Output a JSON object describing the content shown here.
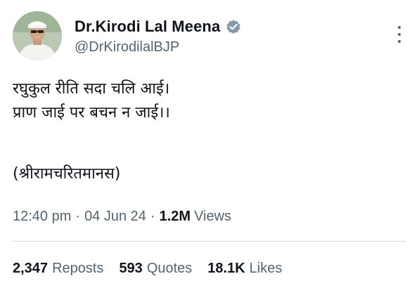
{
  "author": {
    "display_name": "Dr.Kirodi Lal Meena",
    "handle": "@DrKirodilalBJP",
    "verified": true,
    "avatar_icon": "profile-photo"
  },
  "tweet": {
    "lines": [
      "रघुकुल रीति सदा चलि आई।",
      "प्राण जाई पर बचन न जाई।।"
    ],
    "source": "(श्रीरामचरितमानस)"
  },
  "meta": {
    "time": "12:40 pm",
    "separator": "·",
    "date": "04 Jun 24",
    "views_count": "1.2M",
    "views_label": "Views"
  },
  "stats": {
    "reposts_count": "2,347",
    "reposts_label": "Reposts",
    "quotes_count": "593",
    "quotes_label": "Quotes",
    "likes_count": "18.1K",
    "likes_label": "Likes"
  },
  "colors": {
    "text_primary": "#0f1419",
    "text_secondary": "#536471",
    "verified_badge": "#829aab",
    "divider": "#cfd9de"
  }
}
